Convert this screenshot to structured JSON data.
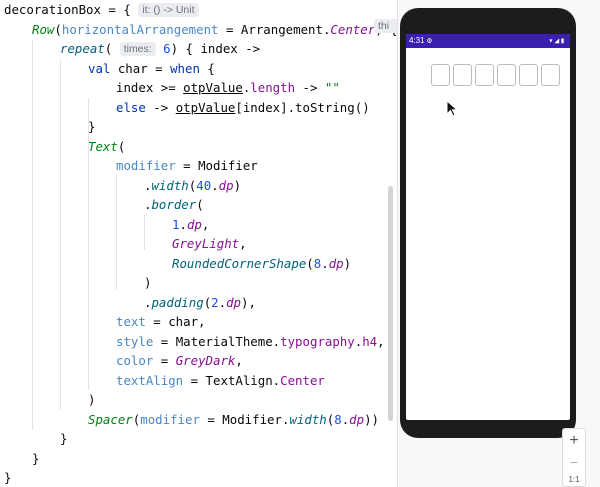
{
  "editor": {
    "lines": [
      {
        "indent": 0,
        "parts": [
          [
            "",
            "decorationBox = { "
          ],
          [
            "hint",
            "it: () -> Unit"
          ]
        ]
      },
      {
        "indent": 1,
        "parts": [
          [
            "fn-green",
            "Row"
          ],
          [
            "",
            "("
          ],
          [
            "param",
            "horizontalArrangement"
          ],
          [
            "",
            " = Arrangement."
          ],
          [
            "prop ital",
            "Center"
          ],
          [
            "",
            ") {"
          ]
        ]
      },
      {
        "indent": 2,
        "parts": [
          [
            "fn",
            "repeat"
          ],
          [
            "",
            "( "
          ],
          [
            "hint",
            "times:"
          ],
          [
            "num",
            " 6"
          ],
          [
            "",
            ") { index ->"
          ]
        ]
      },
      {
        "indent": 3,
        "parts": [
          [
            "kw",
            "val"
          ],
          [
            "",
            " char = "
          ],
          [
            "kw",
            "when"
          ],
          [
            "",
            " {"
          ]
        ]
      },
      {
        "indent": 4,
        "parts": [
          [
            "",
            "index >= "
          ],
          [
            "ul",
            "otpValue"
          ],
          [
            "",
            "."
          ],
          [
            "prop",
            "length"
          ],
          [
            "",
            " -> "
          ],
          [
            "str",
            "\"\""
          ]
        ]
      },
      {
        "indent": 4,
        "parts": [
          [
            "kw",
            "else"
          ],
          [
            "",
            " -> "
          ],
          [
            "ul",
            "otpValue"
          ],
          [
            "",
            "[index].toString()"
          ]
        ]
      },
      {
        "indent": 3,
        "parts": [
          [
            "",
            "}"
          ]
        ]
      },
      {
        "indent": 3,
        "parts": [
          [
            "fn-green",
            "Text"
          ],
          [
            "",
            "("
          ]
        ]
      },
      {
        "indent": 4,
        "parts": [
          [
            "param",
            "modifier"
          ],
          [
            "",
            " = Modifier"
          ]
        ]
      },
      {
        "indent": 5,
        "parts": [
          [
            "",
            "."
          ],
          [
            "fn",
            "width"
          ],
          [
            "",
            "("
          ],
          [
            "num",
            "40"
          ],
          [
            "",
            "."
          ],
          [
            "prop ital",
            "dp"
          ],
          [
            "",
            ")"
          ]
        ]
      },
      {
        "indent": 5,
        "parts": [
          [
            "",
            "."
          ],
          [
            "fn",
            "border"
          ],
          [
            "",
            "("
          ]
        ]
      },
      {
        "indent": 6,
        "parts": [
          [
            "num",
            "1"
          ],
          [
            "",
            "."
          ],
          [
            "prop ital",
            "dp"
          ],
          [
            "",
            ","
          ]
        ]
      },
      {
        "indent": 6,
        "parts": [
          [
            "prop ital",
            "GreyLight"
          ],
          [
            "",
            ","
          ]
        ]
      },
      {
        "indent": 6,
        "parts": [
          [
            "fn",
            "RoundedCornerShape"
          ],
          [
            "",
            "("
          ],
          [
            "num",
            "8"
          ],
          [
            "",
            "."
          ],
          [
            "prop ital",
            "dp"
          ],
          [
            "",
            ")"
          ]
        ]
      },
      {
        "indent": 5,
        "parts": [
          [
            "",
            ")"
          ]
        ]
      },
      {
        "indent": 5,
        "parts": [
          [
            "",
            "."
          ],
          [
            "fn",
            "padding"
          ],
          [
            "",
            "("
          ],
          [
            "num",
            "2"
          ],
          [
            "",
            "."
          ],
          [
            "prop ital",
            "dp"
          ],
          [
            "",
            "),"
          ]
        ]
      },
      {
        "indent": 4,
        "parts": [
          [
            "param",
            "text"
          ],
          [
            "",
            " = char,"
          ]
        ]
      },
      {
        "indent": 4,
        "parts": [
          [
            "param",
            "style"
          ],
          [
            "",
            " = MaterialTheme."
          ],
          [
            "prop",
            "typography"
          ],
          [
            "",
            "."
          ],
          [
            "prop",
            "h4"
          ],
          [
            "",
            ","
          ]
        ]
      },
      {
        "indent": 4,
        "parts": [
          [
            "param",
            "color"
          ],
          [
            "",
            " = "
          ],
          [
            "prop ital",
            "GreyDark"
          ],
          [
            "",
            ","
          ]
        ]
      },
      {
        "indent": 4,
        "parts": [
          [
            "param",
            "textAlign"
          ],
          [
            "",
            " = TextAlign."
          ],
          [
            "prop",
            "Center"
          ]
        ]
      },
      {
        "indent": 3,
        "parts": [
          [
            "",
            ")"
          ]
        ]
      },
      {
        "indent": 3,
        "parts": [
          [
            "fn-green",
            "Spacer"
          ],
          [
            "",
            "("
          ],
          [
            "param",
            "modifier"
          ],
          [
            "",
            " = Modifier."
          ],
          [
            "fn",
            "width"
          ],
          [
            "",
            "("
          ],
          [
            "num",
            "8"
          ],
          [
            "",
            "."
          ],
          [
            "prop ital",
            "dp"
          ],
          [
            "",
            "))"
          ]
        ]
      },
      {
        "indent": 2,
        "parts": [
          [
            "",
            "}"
          ]
        ]
      },
      {
        "indent": 1,
        "parts": [
          [
            "",
            "}"
          ]
        ]
      },
      {
        "indent": 0,
        "parts": [
          [
            "",
            "}"
          ]
        ]
      }
    ],
    "cut_hint": "thi"
  },
  "preview": {
    "status_time": "4:31",
    "status_gear": "⚙",
    "status_icons": "▾◢▮",
    "otp_boxes": [
      "",
      "",
      "",
      "",
      "",
      ""
    ],
    "zoom_in_label": "+",
    "zoom_out_label": "−",
    "zoom_ratio_label": "1:1"
  },
  "colors": {
    "status_bar": "#3a1fb0",
    "phone_frame": "#1c1c1e",
    "otp_border": "#bdbdbd"
  }
}
